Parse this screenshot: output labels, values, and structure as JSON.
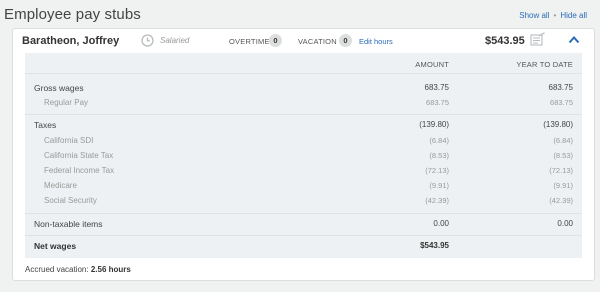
{
  "header": {
    "title": "Employee pay stubs",
    "show_all": "Show all",
    "separator": "•",
    "hide_all": "Hide all"
  },
  "employee": {
    "name": "Baratheon, Joffrey",
    "pay_type": "Salaried",
    "overtime_label": "OVERTIME",
    "overtime_count": "0",
    "vacation_label": "VACATION",
    "vacation_count": "0",
    "edit_hours": "Edit hours",
    "net_amount": "$543.95"
  },
  "table": {
    "col_amount": "AMOUNT",
    "col_ytd": "YEAR TO DATE",
    "gross": {
      "label": "Gross wages",
      "amount": "683.75",
      "ytd": "683.75"
    },
    "regular": {
      "label": "Regular Pay",
      "amount": "683.75",
      "ytd": "683.75"
    },
    "taxes": {
      "label": "Taxes",
      "amount": "(139.80)",
      "ytd": "(139.80)"
    },
    "tax_items": [
      {
        "label": "California SDI",
        "amount": "(6.84)",
        "ytd": "(6.84)"
      },
      {
        "label": "California State Tax",
        "amount": "(8.53)",
        "ytd": "(8.53)"
      },
      {
        "label": "Federal Income Tax",
        "amount": "(72.13)",
        "ytd": "(72.13)"
      },
      {
        "label": "Medicare",
        "amount": "(9.91)",
        "ytd": "(9.91)"
      },
      {
        "label": "Social Security",
        "amount": "(42.39)",
        "ytd": "(42.39)"
      }
    ],
    "nontaxable": {
      "label": "Non-taxable items",
      "amount": "0.00",
      "ytd": "0.00"
    },
    "net": {
      "label": "Net wages",
      "amount": "$543.95"
    }
  },
  "accrued": {
    "label": "Accrued vacation:",
    "value": "2.56 hours"
  },
  "icons": {
    "clock": "clock-icon",
    "doc": "document-icon",
    "collapse": "chevron-up-icon"
  },
  "colors": {
    "link": "#2a6bb8",
    "stub_bg": "#eef1f3"
  }
}
